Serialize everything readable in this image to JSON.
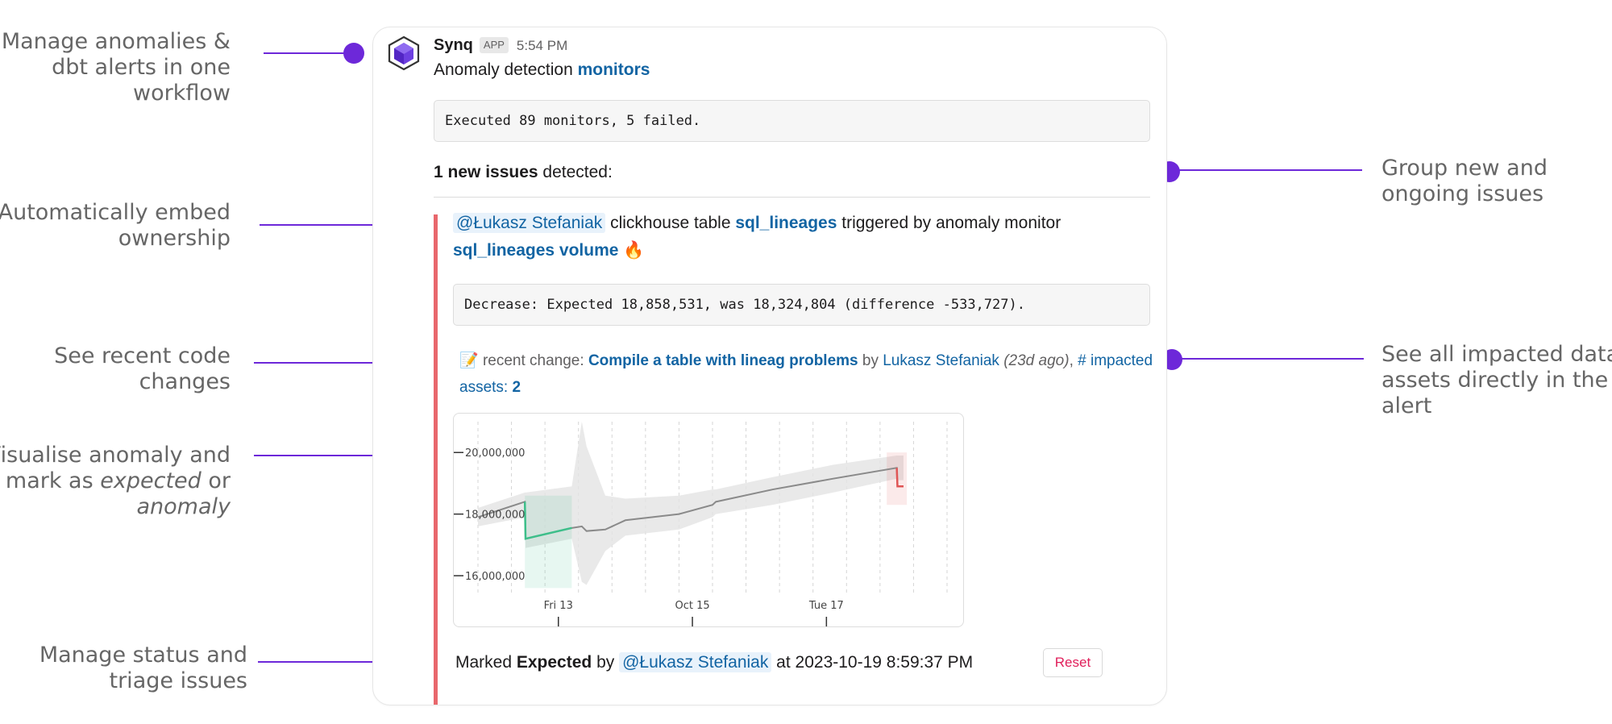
{
  "callouts": {
    "manage": [
      "Manage anomalies &",
      "dbt alerts in one",
      "workflow"
    ],
    "ownership": [
      "Automatically embed",
      "ownership"
    ],
    "code": [
      "See recent code",
      "changes"
    ],
    "visualise": {
      "line1": "Visualise anomaly and",
      "line2_pre": "mark as ",
      "line2_em": "expected",
      "line2_post": " or",
      "line3_em": "anomaly"
    },
    "status": [
      "Manage status and",
      "triage issues"
    ],
    "group": [
      "Group new and",
      "ongoing issues"
    ],
    "impacted": [
      "See all impacted data",
      "assets directly in the",
      "alert"
    ]
  },
  "message": {
    "sender": "Synq",
    "badge": "APP",
    "time": "5:54 PM",
    "subtitle_text": "Anomaly detection ",
    "subtitle_link": "monitors",
    "summary": "Executed 89 monitors, 5 failed.",
    "issues_count": "1 new issues",
    "issues_suffix": " detected:"
  },
  "issue": {
    "mention": "@Łukasz Stefaniak",
    "text1": " clickhouse table ",
    "table_link": "sql_lineages",
    "text2": " triggered by anomaly monitor",
    "monitor_link": "sql_lineages volume",
    "fire": "🔥",
    "detail": "Decrease: Expected 18,858,531, was 18,324,804 (difference -533,727).",
    "memo": "📝",
    "change_label": " recent change: ",
    "change_link": "Compile a table with lineag problems",
    "by": " by ",
    "author": "Lukasz Stefaniak",
    "ago": " (23d ago)",
    "comma": ", ",
    "impacted_label": "# impacted",
    "assets_label": "assets: ",
    "assets_count": "2"
  },
  "status": {
    "marked": "Marked ",
    "state": "Expected",
    "by": " by ",
    "mention": "@Łukasz Stefaniak",
    "at": " at 2023-10-19 8:59:37 PM",
    "reset": "Reset"
  },
  "chart_data": {
    "type": "line",
    "title": "",
    "xlabel": "",
    "ylabel": "",
    "x_ticks": [
      "Fri 13",
      "Oct 15",
      "Tue 17"
    ],
    "y_ticks": [
      "20,000,000",
      "18,000,000",
      "16,000,000"
    ],
    "ylim": [
      15400000,
      21000000
    ],
    "xlim": [
      0,
      7
    ],
    "grid": "vertical dashed",
    "series": [
      {
        "values_x": [
          0,
          0.7,
          0.71,
          1.4,
          1.55,
          1.62,
          1.9,
          2.2,
          3.0,
          3.5,
          3.55,
          4.4,
          5.3,
          6.25,
          6.26,
          6.35
        ],
        "values_y": [
          17900000,
          18400000,
          17200000,
          17550000,
          17600000,
          17450000,
          17500000,
          17800000,
          18000000,
          18300000,
          18400000,
          18800000,
          19150000,
          19500000,
          18900000,
          18900000
        ]
      }
    ],
    "band_lower": [
      17600000,
      17900000,
      16900000,
      17200000,
      15800000,
      15700000,
      16800000,
      17300000,
      17500000,
      17900000,
      18000000,
      18300000,
      18700000,
      19150000,
      19100000,
      19100000
    ],
    "band_upper": [
      18200000,
      18700000,
      18700000,
      18900000,
      21000000,
      20200000,
      18600000,
      18500000,
      18600000,
      18800000,
      18800000,
      19200000,
      19600000,
      19900000,
      19900000,
      19900000
    ],
    "colors": {
      "line": "#8a8a8a",
      "expected_segment": "#3dbf8a",
      "anomaly_segment": "#e05555",
      "band": "#e3e3e3"
    }
  }
}
